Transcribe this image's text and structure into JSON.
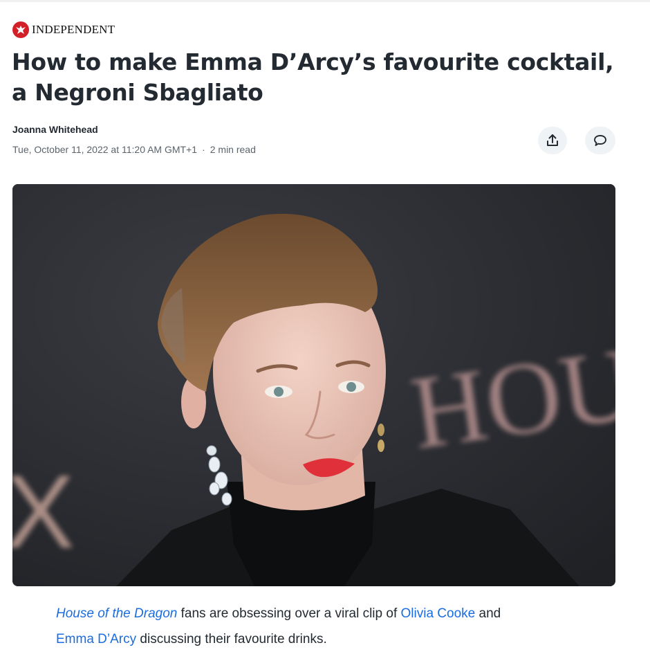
{
  "publisher": {
    "name": "INDEPENDENT",
    "logo_icon": "eagle-icon",
    "brand_color": "#d31f27"
  },
  "article": {
    "headline": "How to make Emma D’Arcy’s favourite cocktail, a Negroni Sbagliato",
    "author": "Joanna Whitehead",
    "timestamp": "Tue, October 11, 2022 at 11:20 AM GMT+1",
    "read_time": "2 min read",
    "separator": "·"
  },
  "actions": {
    "share_icon": "share-icon",
    "comment_icon": "comment-icon"
  },
  "hero_image": {
    "background_text_right": "HOU",
    "background_text_left": "X"
  },
  "body": {
    "link_house_of_dragon": "House of the Dragon",
    "text_1": " fans are obsessing over a viral clip of ",
    "link_olivia": "Olivia Cooke",
    "text_2": " and",
    "link_emma": "Emma D’Arcy",
    "text_3": " discussing their favourite drinks.",
    "link_color": "#1b6ce0"
  }
}
